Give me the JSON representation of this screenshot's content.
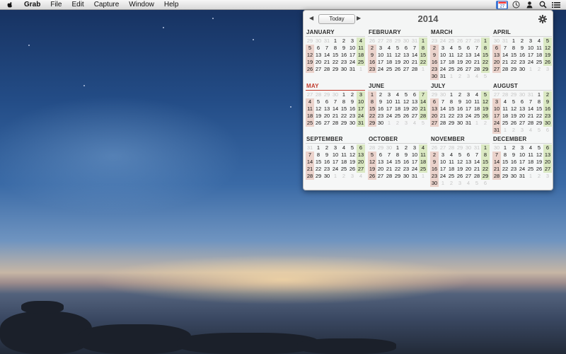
{
  "menubar": {
    "apple_icon": "apple-logo-icon",
    "items": [
      "Grab",
      "File",
      "Edit",
      "Capture",
      "Window",
      "Help"
    ],
    "status_icons": [
      "calendar-icon",
      "clock-icon",
      "user-icon",
      "spotlight-search-icon",
      "list-icon"
    ],
    "calendar_status_label": "27"
  },
  "calendar": {
    "year": "2014",
    "today_label": "Today",
    "prev_icon": "chevron-left-icon",
    "next_icon": "chevron-right-icon",
    "gear_icon": "gear-icon",
    "current_month": "MAY",
    "colors": {
      "highlight_red": "#e2b6aa",
      "highlight_green": "#d2e4b2",
      "current_month": "#c0392b"
    },
    "months": [
      {
        "name": "JANUARY",
        "start": 3,
        "days": 31,
        "prevdays": 31
      },
      {
        "name": "FEBRUARY",
        "start": 6,
        "days": 28,
        "prevdays": 31
      },
      {
        "name": "MARCH",
        "start": 6,
        "days": 31,
        "prevdays": 28
      },
      {
        "name": "APRIL",
        "start": 2,
        "days": 30,
        "prevdays": 31
      },
      {
        "name": "MAY",
        "start": 4,
        "days": 31,
        "prevdays": 30
      },
      {
        "name": "JUNE",
        "start": 0,
        "days": 30,
        "prevdays": 31
      },
      {
        "name": "JULY",
        "start": 2,
        "days": 31,
        "prevdays": 30
      },
      {
        "name": "AUGUST",
        "start": 5,
        "days": 31,
        "prevdays": 31
      },
      {
        "name": "SEPTEMBER",
        "start": 1,
        "days": 30,
        "prevdays": 31
      },
      {
        "name": "OCTOBER",
        "start": 3,
        "days": 31,
        "prevdays": 30
      },
      {
        "name": "NOVEMBER",
        "start": 6,
        "days": 30,
        "prevdays": 31
      },
      {
        "name": "DECEMBER",
        "start": 1,
        "days": 31,
        "prevdays": 30
      }
    ]
  }
}
